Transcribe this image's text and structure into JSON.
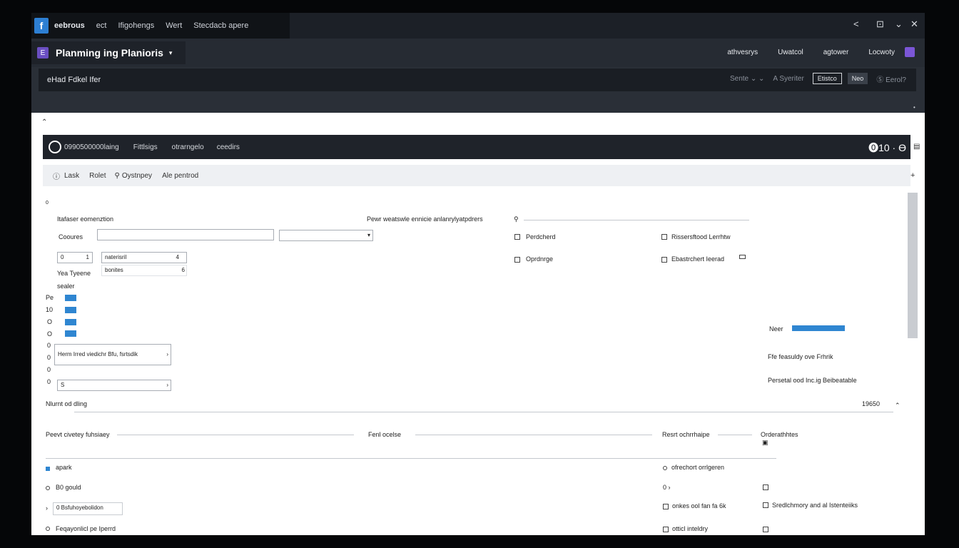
{
  "topbar": {
    "brand": "eebrous",
    "tabs": [
      "ect",
      "Ifigohengs",
      "Wert",
      "Stecdacb apere"
    ],
    "controls": [
      "<",
      "⊡",
      "⌄",
      "✕"
    ]
  },
  "project": {
    "title": "Planming ing Planioris",
    "links": [
      "athvesrys",
      "Uwatcol",
      "agtower",
      "Locwoty"
    ]
  },
  "subheader": {
    "title": "eHad Fdkel Ifer",
    "right_items": [
      "Sente ⌄ ⌄",
      "A Syeriter"
    ],
    "button_outline": "Etistco",
    "button_dark": "Neo",
    "right_tail": "Ⓢ Eerol?"
  },
  "darkbar": {
    "items": [
      "0990500000laing",
      "Fittlsigs",
      "otrarngelo",
      "ceedirs"
    ],
    "right": "⓿10 · Ɵ"
  },
  "toolbar": {
    "items": [
      "Lask",
      "Rolet",
      "Oystnpey",
      "Ale pentrod"
    ]
  },
  "form": {
    "section_label": "Itafaser eomenztion",
    "courses_label": "Cooures",
    "num1": "0",
    "num1_suffix": "1",
    "numeral_label": "naterisril",
    "numeral_value": "4",
    "ye_label": "Yea Tyeene",
    "combo_value": "bonites",
    "combo_suffix": "6",
    "sub_label": "sealer",
    "rows": [
      "Pe",
      "10",
      "O",
      "O"
    ],
    "side_numbers": [
      "0",
      "0",
      "10",
      "0",
      "0",
      "0",
      "0"
    ],
    "select1_value": "Herm Irred viedichr Bfu, fsrtsdik",
    "select2_value": "S",
    "footer_label": "Nlurnt od dling",
    "footer_value": "19650"
  },
  "right_panel": {
    "header": "Pewr weatswle ennicie anlanrylyatpdrers",
    "opts": [
      "Perdcherd",
      "Rissersftood Lerrhtw",
      "Oprdnrge",
      "Ebastrchert Ieerad"
    ],
    "progress_label": "Neer",
    "progress_value": 1.0,
    "line1": "Ffe feasuldy ove Frhrik",
    "line2": "Persetal ood Inc.ig Beibeatable"
  },
  "lower": {
    "headers": [
      "Peevt civetey fuhsiaey",
      "Fenl ocelse",
      "Resrt ochrrhaipe",
      "Orderathhtes"
    ],
    "left_rows": [
      "apark",
      "B0 gould",
      "0 Bsfuhoyebolidon",
      "Feqayonlicl pe Iperrd"
    ],
    "mid_rows": [
      "ofrechort orrlgeren",
      "0 ›",
      "onkes ool fan fa 6k",
      "otticl inteldry"
    ],
    "right_rows": [
      "Sredlchmory and al Istenteiiks"
    ]
  }
}
